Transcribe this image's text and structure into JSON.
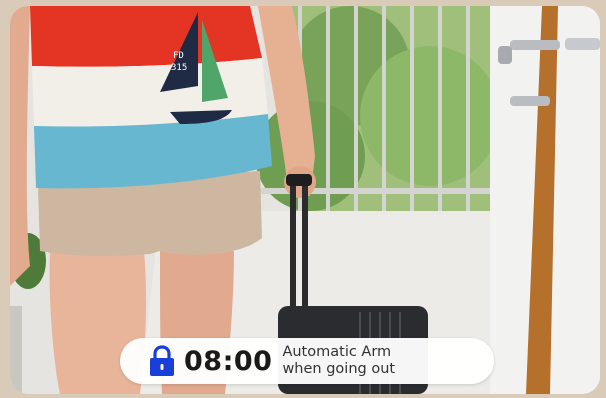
{
  "caption": {
    "time": "08:00",
    "line1": "Automatic Arm",
    "line2": "when going out",
    "icon": "lock-icon",
    "icon_color": "#1a3fd8"
  },
  "shirt_print": {
    "line1": "FD",
    "line2": "315"
  }
}
